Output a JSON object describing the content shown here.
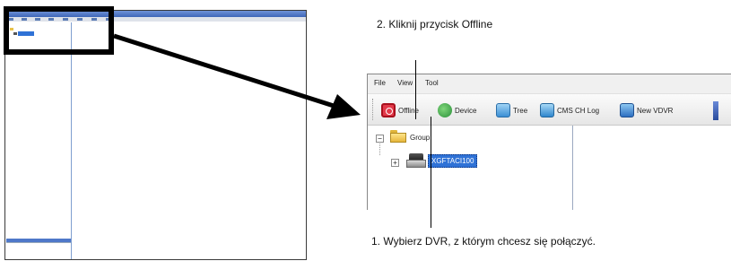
{
  "callouts": {
    "step2": "2. Kliknij przycisk Offline",
    "step1": "1. Wybierz DVR, z którym chcesz się połączyć."
  },
  "app": {
    "menu": [
      "File",
      "View",
      "Tool"
    ],
    "toolbar": [
      {
        "label": "Offline",
        "icon": "offline-icon"
      },
      {
        "label": "Device",
        "icon": "device-icon"
      },
      {
        "label": "Tree",
        "icon": "tree-icon"
      },
      {
        "label": "CMS CH Log",
        "icon": "cms-log-icon"
      },
      {
        "label": "New VDVR",
        "icon": "new-vdvr-icon"
      }
    ],
    "tree": {
      "group_label": "Group",
      "device_label": "XGFTACI100"
    }
  },
  "colors": {
    "selection": "#2f72d6",
    "titlebar": "#3f66b8",
    "highlight_border": "#000000"
  }
}
